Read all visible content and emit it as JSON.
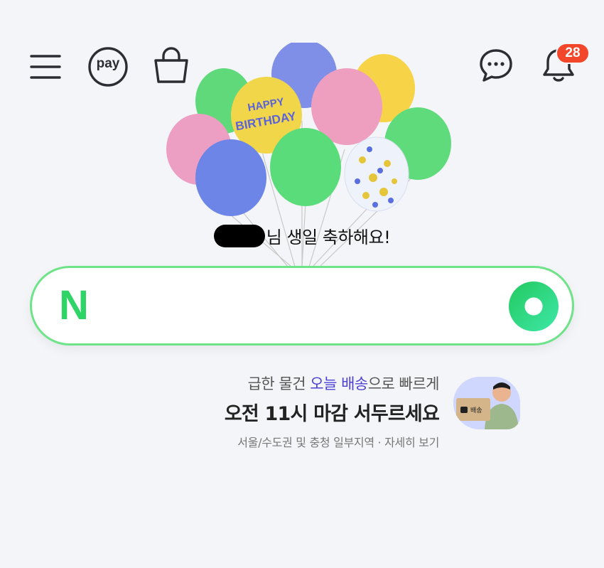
{
  "header": {
    "menu_icon": "hamburger-menu-icon",
    "pay_label": "pay",
    "shopping_icon": "shopping-bag-icon",
    "chat_icon": "chat-bubble-icon",
    "bell_icon": "bell-icon",
    "notification_count": "28"
  },
  "greeting": {
    "text": "님 생일 축하해요!"
  },
  "search": {
    "logo": "N",
    "value": "",
    "submit_icon": "green-search-circle-icon"
  },
  "promo": {
    "line1_prefix": "급한 물건 ",
    "line1_highlight": "오늘 배송",
    "line1_suffix": "으로 빠르게",
    "line2": "오전 11시 마감 서두르세요",
    "line3": "서울/수도권 및 충청 일부지역 · 자세히 보기",
    "box_label": "배송"
  },
  "colors": {
    "accent_green": "#2ed466",
    "badge_red": "#f2472b",
    "highlight_purple": "#4b3fd6",
    "background": "#f4f5f8"
  }
}
